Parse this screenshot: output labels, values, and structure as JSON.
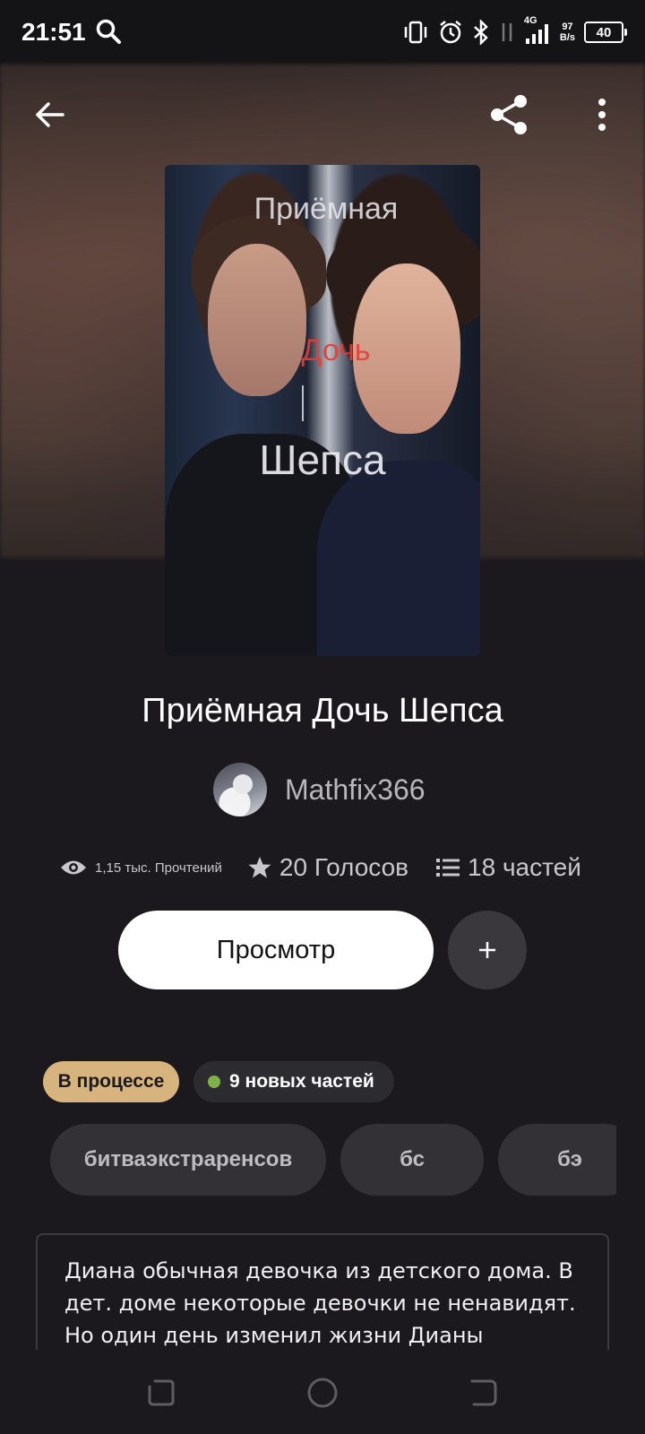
{
  "status_bar": {
    "time": "21:51",
    "network_type": "4G",
    "net_speed_value": "97",
    "net_speed_unit": "B/s",
    "battery": "40"
  },
  "cover": {
    "line1": "Приёмная",
    "line2": "Дочь",
    "line3": "Шепса"
  },
  "story": {
    "title": "Приёмная Дочь Шепса",
    "author": "Mathfix366",
    "reads": "1,15 тыс. Прочтений",
    "votes": "20 Голосов",
    "parts": "18 частей"
  },
  "actions": {
    "read_label": "Просмотр",
    "add_label": "+"
  },
  "badges": {
    "status": "В процессе",
    "new_parts": "9 новых частей"
  },
  "tags": [
    "битваэкстраренсов",
    "бс",
    "бэ"
  ],
  "description": "Диана обычная девочка из детского дома. В дет. доме некоторые девочки не ненавидят. Но один день изменил жизни Дианы",
  "colors": {
    "background": "#1b191d",
    "status_badge": "#d7b47e",
    "new_dot": "#7fb04a",
    "primary_button": "#ffffff"
  },
  "icons": {
    "back": "arrow-left-icon",
    "share": "share-icon",
    "more": "more-vertical-icon",
    "reads": "eye-icon",
    "votes": "star-icon",
    "parts": "list-icon"
  }
}
